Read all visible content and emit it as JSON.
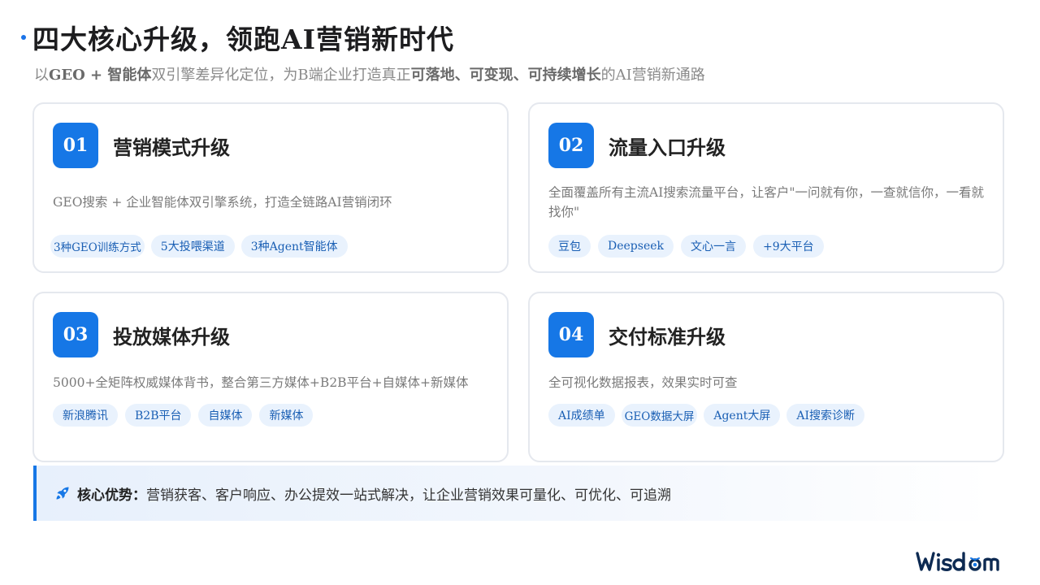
{
  "header": {
    "title": "四大核心升级，领跑AI营销新时代",
    "subtitle_prefix": "以",
    "subtitle_bold1": "GEO + 智能体",
    "subtitle_mid": "双引擎差异化定位，为B端企业打造真正",
    "subtitle_bold2": "可落地、可变现、可持续增长",
    "subtitle_suffix": "的AI营销新通路"
  },
  "cards": [
    {
      "number": "01",
      "title": "营销模式升级",
      "desc": "GEO搜索 + 企业智能体双引擎系统，打造全链路AI营销闭环",
      "tags": [
        "3种GEO训练方式",
        "5大投喂渠道",
        "3种Agent智能体"
      ]
    },
    {
      "number": "02",
      "title": "流量入口升级",
      "desc": "全面覆盖所有主流AI搜索流量平台，让客户\"一问就有你，一查就信你，一看就找你\"",
      "tags": [
        "豆包",
        "Deepseek",
        "文心一言",
        "+9大平台"
      ]
    },
    {
      "number": "03",
      "title": "投放媒体升级",
      "desc": "5000+全矩阵权威媒体背书，整合第三方媒体+B2B平台+自媒体+新媒体",
      "tags": [
        "新浪腾讯",
        "B2B平台",
        "自媒体",
        "新媒体"
      ]
    },
    {
      "number": "04",
      "title": "交付标准升级",
      "desc": "全可视化数据报表，效果实时可查",
      "tags": [
        "AI成绩单",
        "GEO数据大屏",
        "Agent大屏",
        "AI搜索诊断"
      ]
    }
  ],
  "advantage": {
    "icon": "rocket-icon",
    "label": "核心优势：",
    "text": "营销获客、客户响应、办公提效一站式解决，让企业营销效果可量化、可优化、可追溯"
  },
  "brand": {
    "logo_text": "Wisdom",
    "color": "#0d2a52"
  },
  "colors": {
    "accent": "#1677e6",
    "tag_bg": "#e9f2fd",
    "tag_text": "#1a5fb4"
  }
}
